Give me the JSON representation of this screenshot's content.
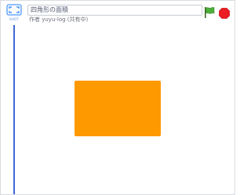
{
  "header": {
    "fullscreen_label": "SHOT",
    "project_title": "四角形の面積",
    "author_line": "作者 yuyu-log (共有中)",
    "green_flag_icon": "green-flag-icon",
    "stop_icon": "stop-icon"
  },
  "stage": {
    "rectangle_color": "#ff9900",
    "pen_line_color": "#3f68d6"
  },
  "colors": {
    "flag_green": "#4cae3a",
    "stop_red": "#ec1c24",
    "accent_blue": "#4c97ff"
  }
}
